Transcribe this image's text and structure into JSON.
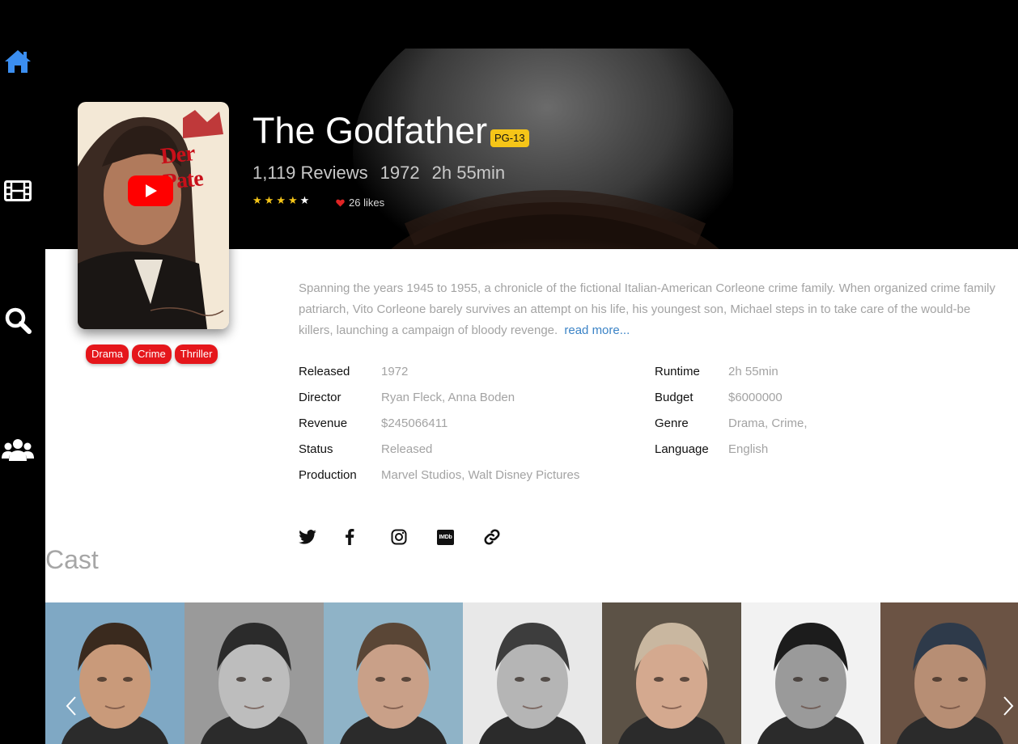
{
  "nav": {
    "items": [
      {
        "icon": "home-icon",
        "color": "#3b8ef0"
      },
      {
        "icon": "film-icon",
        "color": "#ffffff"
      },
      {
        "icon": "search-icon",
        "color": "#ffffff"
      },
      {
        "icon": "users-icon",
        "color": "#ffffff"
      }
    ]
  },
  "movie": {
    "title": "The Godfather",
    "rating_badge": "PG-13",
    "reviews": "1,119 Reviews",
    "year": "1972",
    "runtime": "2h 55min",
    "stars": 4,
    "likes": "26 likes",
    "description": "Spanning the years 1945 to 1955, a chronicle of the fictional Italian-American Corleone crime family. When organized crime family patriarch, Vito Corleone barely survives an attempt on his life, his youngest son, Michael steps in to take care of the would-be killers, launching a campaign of bloody revenge.",
    "read_more": "read more...",
    "genres": [
      "Drama",
      "Crime",
      "Thriller"
    ],
    "poster_text": "Der Pate"
  },
  "details": {
    "left": [
      {
        "label": "Released",
        "value": "1972"
      },
      {
        "label": "Director",
        "value": "Ryan Fleck, Anna Boden"
      },
      {
        "label": "Revenue",
        "value": "$245066411"
      },
      {
        "label": "Status",
        "value": "Released"
      },
      {
        "label": "Production",
        "value": "Marvel Studios, Walt Disney Pictures"
      }
    ],
    "right": [
      {
        "label": "Runtime",
        "value": "2h 55min"
      },
      {
        "label": "Budget",
        "value": "$6000000"
      },
      {
        "label": "Genre",
        "value": "Drama, Crime,"
      },
      {
        "label": "Language",
        "value": "English"
      }
    ]
  },
  "social": {
    "icons": [
      "twitter-icon",
      "facebook-icon",
      "instagram-icon",
      "imdb-icon",
      "link-icon"
    ],
    "imdb_label": "IMDb"
  },
  "cast": {
    "heading": "Cast",
    "members": [
      {
        "bg": "#7fa8c4",
        "skin": "#c99a7a",
        "hair": "#3a2a1e"
      },
      {
        "bg": "#9a9a9a",
        "skin": "#bdbdbd",
        "hair": "#2b2b2b"
      },
      {
        "bg": "#8fb3c7",
        "skin": "#c9a088",
        "hair": "#5a4636"
      },
      {
        "bg": "#e8e8e8",
        "skin": "#b5b5b5",
        "hair": "#3d3d3d"
      },
      {
        "bg": "#5c5246",
        "skin": "#d4a98f",
        "hair": "#c9b7a0"
      },
      {
        "bg": "#f2f2f2",
        "skin": "#9a9a9a",
        "hair": "#1c1c1c"
      },
      {
        "bg": "#6b5344",
        "skin": "#b78e74",
        "hair": "#2e3a4a"
      }
    ]
  },
  "colors": {
    "accent": "#3b83c6",
    "genre": "#e5161b",
    "badge": "#f5c518",
    "star": "#f5c518",
    "heart": "#e02424"
  }
}
